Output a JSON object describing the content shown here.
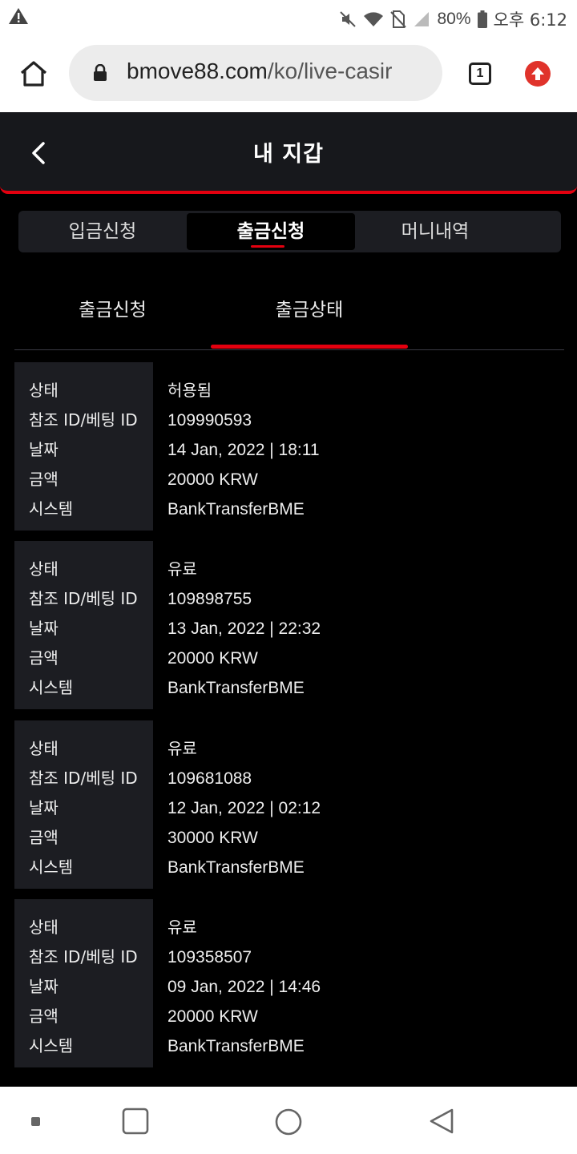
{
  "status_bar": {
    "battery": "80%",
    "time": "오후 6:12"
  },
  "browser": {
    "url_host": "bmove88.com",
    "url_path": "/ko/live-casir",
    "tab_count": "1"
  },
  "header": {
    "title": "내 지갑"
  },
  "main_tabs": [
    {
      "label": "입금신청"
    },
    {
      "label": "출금신청"
    },
    {
      "label": "머니내역"
    }
  ],
  "sub_tabs": [
    {
      "label": "출금신청"
    },
    {
      "label": "출금상태"
    }
  ],
  "field_labels": {
    "status": "상태",
    "ref_id": "참조 ID/베팅 ID",
    "date": "날짜",
    "amount": "금액",
    "system": "시스템"
  },
  "records": [
    {
      "status": "허용됨",
      "ref_id": "109990593",
      "date": "14 Jan, 2022 | 18:11",
      "amount": "20000 KRW",
      "system": "BankTransferBME"
    },
    {
      "status": "유료",
      "ref_id": "109898755",
      "date": "13 Jan, 2022 | 22:32",
      "amount": "20000 KRW",
      "system": "BankTransferBME"
    },
    {
      "status": "유료",
      "ref_id": "109681088",
      "date": "12 Jan, 2022 | 02:12",
      "amount": "30000 KRW",
      "system": "BankTransferBME"
    },
    {
      "status": "유료",
      "ref_id": "109358507",
      "date": "09 Jan, 2022 | 14:46",
      "amount": "20000 KRW",
      "system": "BankTransferBME"
    }
  ],
  "colors": {
    "accent": "#e3000f",
    "background": "#000000",
    "panel": "#1c1d22"
  }
}
